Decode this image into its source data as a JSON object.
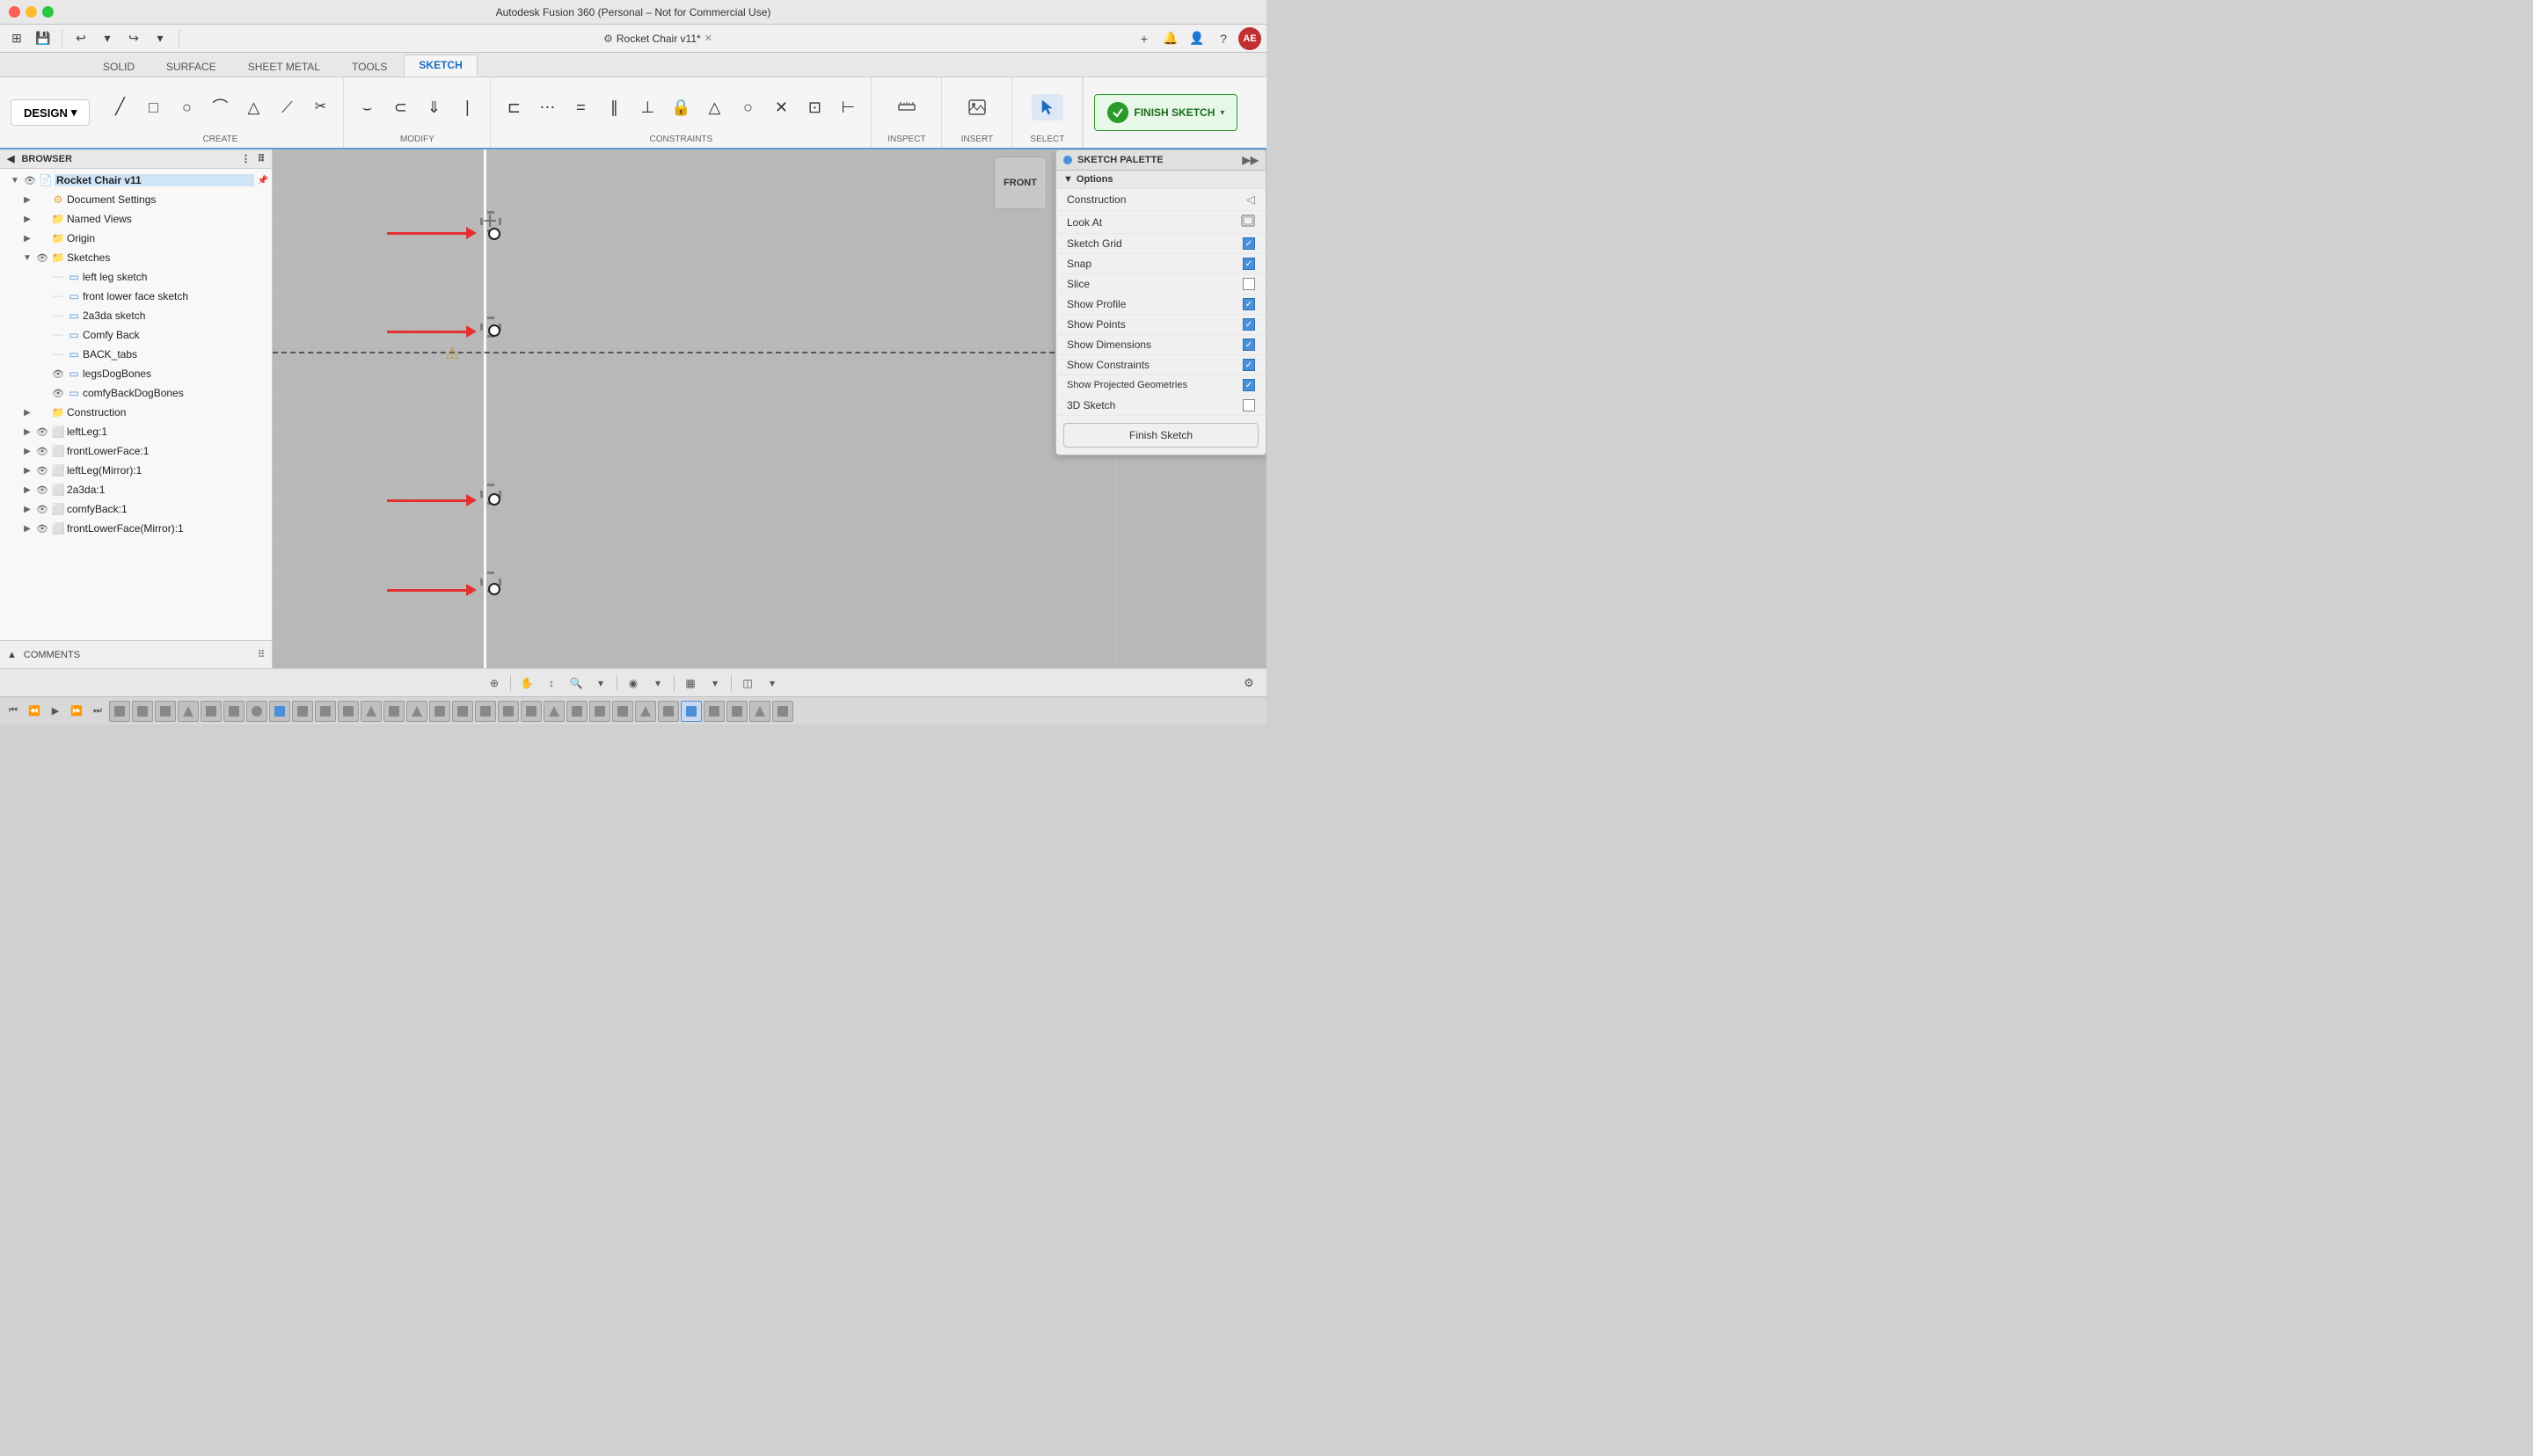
{
  "app": {
    "title": "Autodesk Fusion 360 (Personal – Not for Commercial Use)",
    "tab_title": "Rocket Chair v11*"
  },
  "ribbon_tabs": [
    {
      "id": "solid",
      "label": "SOLID",
      "active": false
    },
    {
      "id": "surface",
      "label": "SURFACE",
      "active": false
    },
    {
      "id": "sheet_metal",
      "label": "SHEET METAL",
      "active": false
    },
    {
      "id": "tools",
      "label": "TOOLS",
      "active": false
    },
    {
      "id": "sketch",
      "label": "SKETCH",
      "active": true
    }
  ],
  "ribbon_groups": {
    "create_label": "CREATE",
    "modify_label": "MODIFY",
    "constraints_label": "CONSTRAINTS",
    "inspect_label": "INSPECT",
    "insert_label": "INSERT",
    "select_label": "SELECT",
    "finish_sketch_label": "FINISH SKETCH"
  },
  "design_btn": "DESIGN",
  "browser": {
    "header": "BROWSER",
    "items": [
      {
        "id": "rocket-chair",
        "label": "Rocket Chair v11",
        "level": 0,
        "expand": true,
        "eye": true,
        "icon": "📄",
        "selected": false
      },
      {
        "id": "doc-settings",
        "label": "Document Settings",
        "level": 1,
        "expand": false,
        "eye": false,
        "icon": "⚙️",
        "selected": false
      },
      {
        "id": "named-views",
        "label": "Named Views",
        "level": 1,
        "expand": false,
        "eye": false,
        "icon": "📁",
        "selected": false
      },
      {
        "id": "origin",
        "label": "Origin",
        "level": 1,
        "expand": false,
        "eye": false,
        "icon": "📁",
        "selected": false
      },
      {
        "id": "sketches",
        "label": "Sketches",
        "level": 1,
        "expand": true,
        "eye": true,
        "icon": "📁",
        "selected": false
      },
      {
        "id": "left-leg-sketch",
        "label": "left leg sketch",
        "level": 2,
        "expand": false,
        "eye": false,
        "icon": "▭",
        "selected": false
      },
      {
        "id": "front-lower-face-sketch",
        "label": "front lower face sketch",
        "level": 2,
        "expand": false,
        "eye": false,
        "icon": "▭",
        "selected": false
      },
      {
        "id": "2a3da-sketch",
        "label": "2a3da sketch",
        "level": 2,
        "expand": false,
        "eye": false,
        "icon": "▭",
        "selected": false
      },
      {
        "id": "comfy-back",
        "label": "Comfy Back",
        "level": 2,
        "expand": false,
        "eye": false,
        "icon": "▭",
        "selected": false
      },
      {
        "id": "back-tabs",
        "label": "BACK_tabs",
        "level": 2,
        "expand": false,
        "eye": false,
        "icon": "▭",
        "selected": false
      },
      {
        "id": "legs-dog-bones",
        "label": "legsDogBones",
        "level": 2,
        "expand": false,
        "eye": true,
        "icon": "▭",
        "selected": false
      },
      {
        "id": "comfy-back-dog-bones",
        "label": "comfyBackDogBones",
        "level": 2,
        "expand": false,
        "eye": true,
        "icon": "▭",
        "selected": false
      },
      {
        "id": "construction",
        "label": "Construction",
        "level": 1,
        "expand": false,
        "eye": false,
        "icon": "📁",
        "selected": false
      },
      {
        "id": "left-leg-1",
        "label": "leftLeg:1",
        "level": 1,
        "expand": false,
        "eye": true,
        "icon": "⬜",
        "selected": false
      },
      {
        "id": "front-lower-face-1",
        "label": "frontLowerFace:1",
        "level": 1,
        "expand": false,
        "eye": true,
        "icon": "⬜",
        "selected": false
      },
      {
        "id": "left-leg-mirror-1",
        "label": "leftLeg(Mirror):1",
        "level": 1,
        "expand": false,
        "eye": true,
        "icon": "⬜",
        "selected": false
      },
      {
        "id": "2a3da-1",
        "label": "2a3da:1",
        "level": 1,
        "expand": false,
        "eye": true,
        "icon": "⬜",
        "selected": false
      },
      {
        "id": "comfy-back-1",
        "label": "comfyBack:1",
        "level": 1,
        "expand": false,
        "eye": true,
        "icon": "⬜",
        "selected": false
      },
      {
        "id": "front-lower-face-mirror-1",
        "label": "frontLowerFace(Mirror):1",
        "level": 1,
        "expand": false,
        "eye": true,
        "icon": "⬜",
        "selected": false
      }
    ]
  },
  "comments_bar": {
    "label": "COMMENTS"
  },
  "sketch_palette": {
    "title": "SKETCH PALETTE",
    "sections": {
      "options_label": "Options"
    },
    "rows": [
      {
        "id": "construction",
        "label": "Construction",
        "checked": false,
        "icon": "◁"
      },
      {
        "id": "look-at",
        "label": "Look At",
        "checked": false,
        "icon": "📷"
      },
      {
        "id": "sketch-grid",
        "label": "Sketch Grid",
        "checked": true
      },
      {
        "id": "snap",
        "label": "Snap",
        "checked": true
      },
      {
        "id": "slice",
        "label": "Slice",
        "checked": false
      },
      {
        "id": "show-profile",
        "label": "Show Profile",
        "checked": true
      },
      {
        "id": "show-points",
        "label": "Show Points",
        "checked": true
      },
      {
        "id": "show-dimensions",
        "label": "Show Dimensions",
        "checked": true
      },
      {
        "id": "show-constraints",
        "label": "Show Constraints",
        "checked": true
      },
      {
        "id": "show-projected-geometries",
        "label": "Show Projected Geometries",
        "checked": true
      },
      {
        "id": "3d-sketch",
        "label": "3D Sketch",
        "checked": false
      }
    ],
    "finish_btn": "Finish Sketch"
  },
  "viewcube": {
    "label": "FRONT"
  },
  "bottom_toolbar": {
    "icons": [
      "⊕",
      "✋",
      "↕",
      "🔍",
      "◉",
      "▦",
      "▪",
      "◫",
      "⚙"
    ]
  },
  "timeline": {
    "items_count": 30
  }
}
